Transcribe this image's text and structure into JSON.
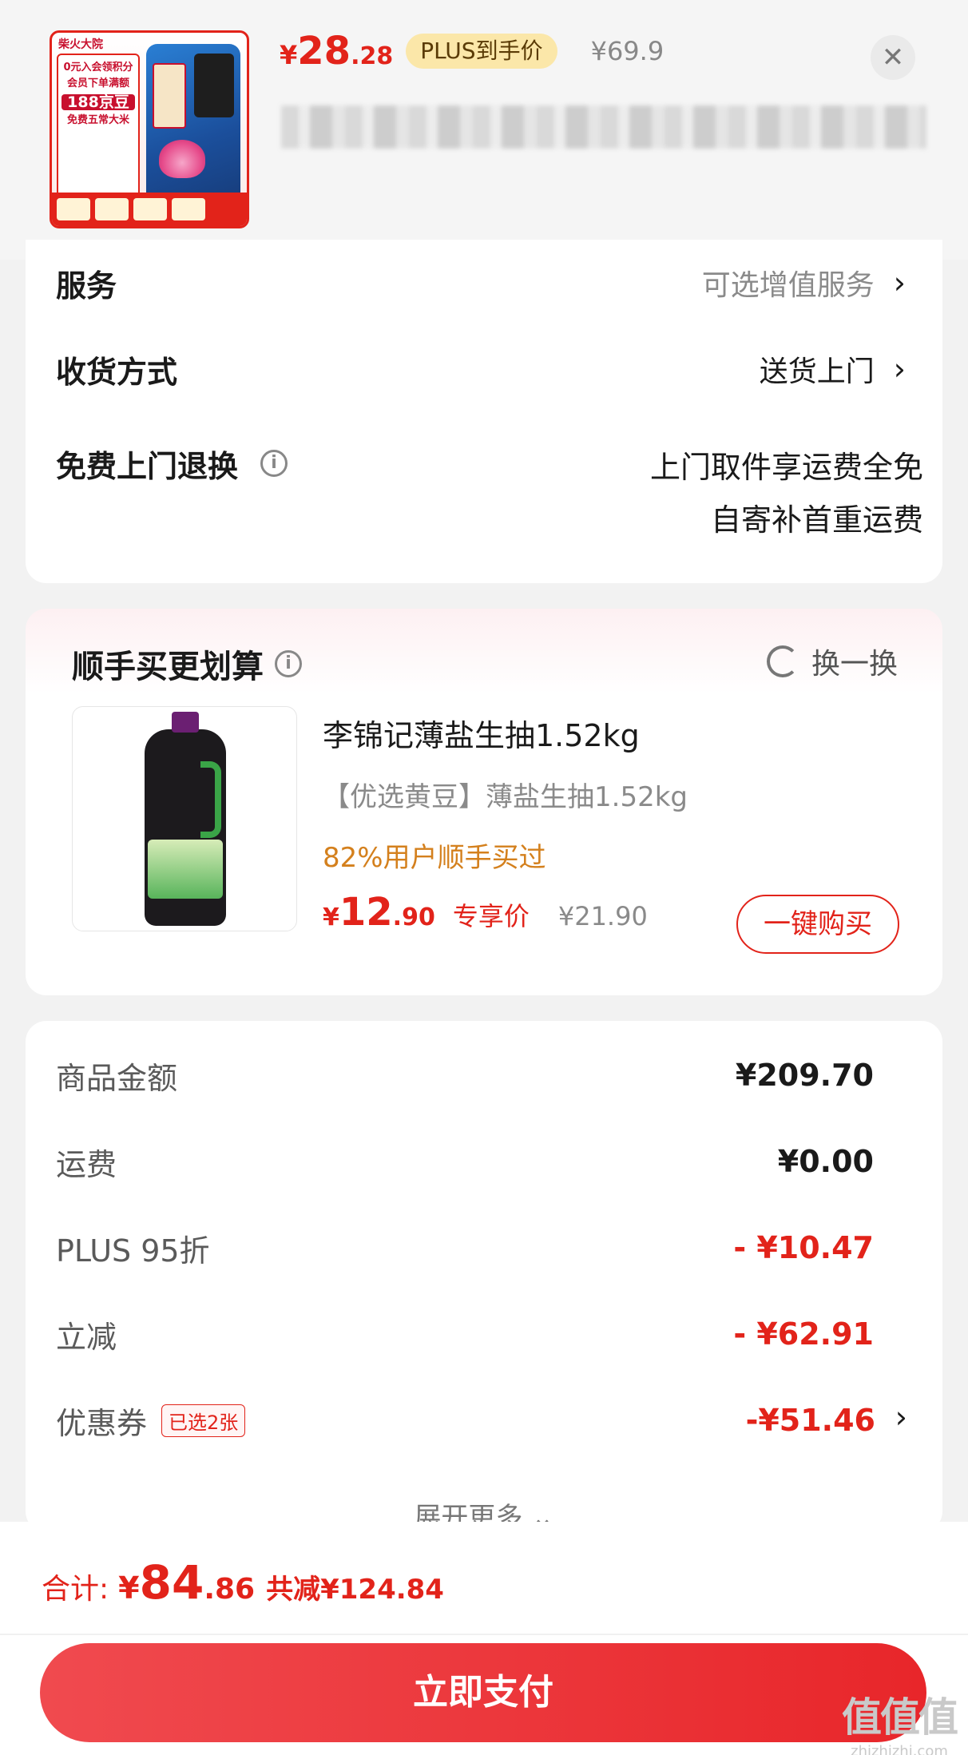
{
  "header": {
    "product_image_brand": "柴火大院",
    "product_image_lines": [
      "0元入会领积分",
      "会员下单满额",
      "188京豆",
      "免费五常大米"
    ],
    "price_symbol": "¥",
    "price_int": "28",
    "price_dec": ".28",
    "plus_badge": "PLUS到手价",
    "old_price": "¥69.9",
    "close_icon": "close-icon"
  },
  "service": {
    "service_label": "服务",
    "service_value": "可选增值服务",
    "delivery_label": "收货方式",
    "delivery_value": "送货上门",
    "return_label": "免费上门退换",
    "return_value_line1": "上门取件享运费全免",
    "return_value_line2": "自寄补首重运费",
    "chevron": "›"
  },
  "addon": {
    "title": "顺手买更划算",
    "refresh_label": "换一换",
    "name": "李锦记薄盐生抽1.52kg",
    "subtitle": "【优选黄豆】薄盐生抽1.52kg",
    "stat": "82%用户顺手买过",
    "price_symbol": "¥",
    "price_int": "12",
    "price_dec": ".90",
    "price_tag": "专享价",
    "old_price": "¥21.90",
    "buy_button": "一键购买"
  },
  "summary": {
    "rows": [
      {
        "label": "商品金额",
        "value": "¥209.70"
      },
      {
        "label": "运费",
        "value": "¥0.00"
      },
      {
        "label": "PLUS 95折",
        "value": "- ¥10.47"
      },
      {
        "label": "立减",
        "value": "- ¥62.91"
      },
      {
        "label": "优惠券",
        "value": "-¥51.46",
        "tag": "已选2张"
      }
    ],
    "expand_label": "展开更多 ⌄"
  },
  "footer": {
    "total_label": "合计:",
    "total_symbol": "¥",
    "total_int": "84",
    "total_dec": ".86",
    "saved_text": "共减¥124.84",
    "pay_button": "立即支付"
  },
  "watermark": {
    "logo": "值值值",
    "url": "zhizhizhi.com"
  },
  "colors": {
    "accent_red": "#e2231a",
    "plus_gold": "#fbe7a9",
    "stat_orange": "#d4801d"
  }
}
